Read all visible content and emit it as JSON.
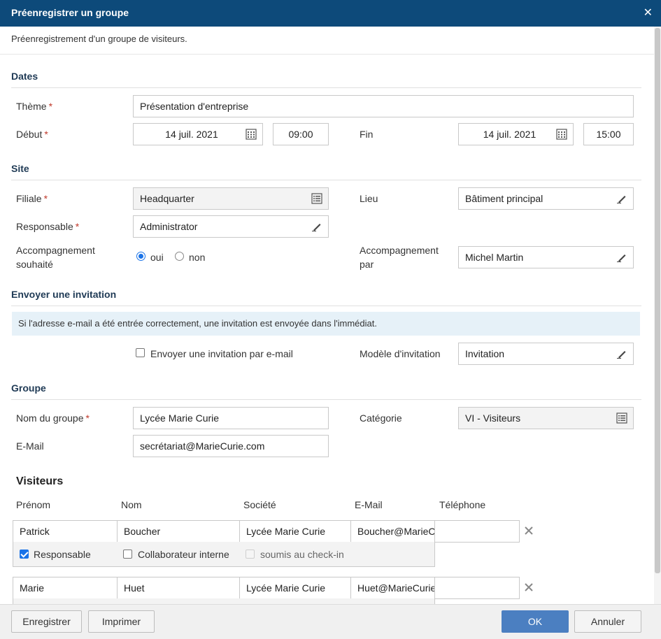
{
  "window": {
    "title": "Préenregistrer un groupe",
    "close_icon": "close-icon"
  },
  "subtitle": "Préenregistrement d'un groupe de visiteurs.",
  "sections": {
    "dates": "Dates",
    "site": "Site",
    "invitation": "Envoyer une invitation",
    "groupe": "Groupe"
  },
  "dates": {
    "theme_label": "Thème",
    "theme_value": "Présentation d'entreprise",
    "debut_label": "Début",
    "debut_date": "14 juil. 2021",
    "debut_time": "09:00",
    "fin_label": "Fin",
    "fin_date": "14 juil. 2021",
    "fin_time": "15:00"
  },
  "site": {
    "filiale_label": "Filiale",
    "filiale_value": "Headquarter",
    "lieu_label": "Lieu",
    "lieu_value": "Bâtiment principal",
    "responsable_label": "Responsable",
    "responsable_value": "Administrator",
    "accompagnement_label_1": "Accompagnement",
    "accompagnement_label_2": "souhaité",
    "oui": "oui",
    "non": "non",
    "accompagnement_selected": "oui",
    "accompagne_par_label_1": "Accompagnement",
    "accompagne_par_label_2": "par",
    "accompagne_par_value": "Michel Martin"
  },
  "invitation": {
    "info": "Si l'adresse e-mail a été entrée correctement, une invitation est envoyée dans l'immédiat.",
    "send_label": "Envoyer une invitation par e-mail",
    "send_checked": false,
    "modele_label": "Modèle d'invitation",
    "modele_value": "Invitation"
  },
  "groupe": {
    "nom_label": "Nom du groupe",
    "nom_value": "Lycée Marie Curie",
    "categorie_label": "Catégorie",
    "categorie_value": "VI - Visiteurs",
    "email_label": "E-Mail",
    "email_value": "secrétariat@MarieCurie.com"
  },
  "visiteurs": {
    "heading": "Visiteurs",
    "columns": [
      "Prénom",
      "Nom",
      "Société",
      "E-Mail",
      "Téléphone"
    ],
    "rows": [
      {
        "prenom": "Patrick",
        "nom": "Boucher",
        "societe": "Lycée Marie Curie",
        "email": "Boucher@MarieCurie.com",
        "telephone": "",
        "responsable_label": "Responsable",
        "responsable": true,
        "interne_label": "Collaborateur interne",
        "interne": false,
        "checkin_label": "soumis au check-in",
        "checkin": false
      },
      {
        "prenom": "Marie",
        "nom": "Huet",
        "societe": "Lycée Marie Curie",
        "email": "Huet@MarieCurie.com",
        "telephone": ""
      }
    ]
  },
  "footer": {
    "save": "Enregistrer",
    "print": "Imprimer",
    "ok": "OK",
    "cancel": "Annuler"
  },
  "colors": {
    "titlebar": "#0d4a7a",
    "primary": "#4b7fc1",
    "required": "#c0392b",
    "info_bg": "#e6f1f8"
  }
}
